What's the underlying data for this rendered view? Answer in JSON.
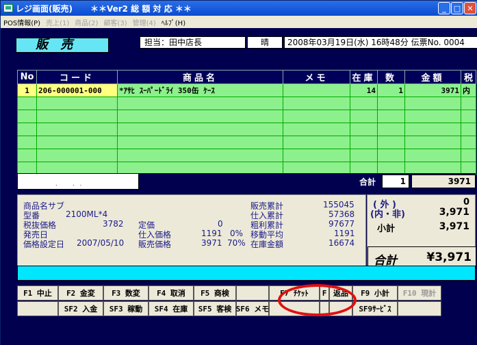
{
  "window": {
    "title": "レジ画面(販売)",
    "subtitle": "＊＊Ver2 総 額 対 応 ＊＊"
  },
  "menu": [
    {
      "label": "POS情報(P)",
      "enabled": true
    },
    {
      "label": "売上(1)",
      "enabled": false
    },
    {
      "label": "商品(2)",
      "enabled": false
    },
    {
      "label": "顧客(3)",
      "enabled": false
    },
    {
      "label": "管理(4)",
      "enabled": false
    },
    {
      "label": "ﾍﾙﾌﾟ(H)",
      "enabled": true
    }
  ],
  "header": {
    "mode": "販 売",
    "tanto": "担当：田中店長",
    "weather": "晴",
    "datetime": "2008年03月19日(水) 16時48分 伝票No. 0004"
  },
  "grid": {
    "columns": [
      "No",
      "コード",
      "商品名",
      "メモ",
      "在庫",
      "数",
      "金額",
      "税"
    ],
    "rows": [
      {
        "no": "1",
        "code": "206-000001-000",
        "name": "*ｱｻﾋ ｽｰﾊﾟｰﾄﾞﾗｲ 350缶 ｹｰｽ",
        "memo": "",
        "stock": "14",
        "qty": "1",
        "amount": "3971",
        "tax": "内"
      }
    ]
  },
  "totals": {
    "label": "合計",
    "qty": "1",
    "amount": "3971"
  },
  "info": {
    "left": [
      {
        "label": "商品名サブ",
        "value": ""
      },
      {
        "label": "型番",
        "value": "2100ML*4"
      },
      {
        "label": "税抜価格",
        "value": "3782"
      },
      {
        "label": "発売日",
        "value": ""
      },
      {
        "label": "価格設定日",
        "value": "2007/05/10"
      }
    ],
    "mid": [
      {
        "label": "定価",
        "value": "0",
        "pct": ""
      },
      {
        "label": "仕入価格",
        "value": "1191",
        "pct": "0%"
      },
      {
        "label": "販売価格",
        "value": "3971",
        "pct": "70%"
      }
    ],
    "right": [
      {
        "label": "販売累計",
        "value": "155045"
      },
      {
        "label": "仕入累計",
        "value": "57368"
      },
      {
        "label": "粗利累計",
        "value": "97677"
      },
      {
        "label": "移動平均",
        "value": "1191"
      },
      {
        "label": "在庫金額",
        "value": "16674"
      }
    ]
  },
  "summary": {
    "outer_label": "( 外 )",
    "outer_value": "0",
    "inner_label": "(内・非)",
    "inner_value": "3,971",
    "subtotal_label": "小計",
    "subtotal_value": "3,971",
    "total_label": "合計",
    "total_value": "¥3,971"
  },
  "fkeys_row1": [
    "F1 中止",
    "F2 金変",
    "F3 数変",
    "F4 取消",
    "F5 商検",
    "",
    "F7 ﾁｹｯﾄ",
    "F",
    "返品",
    "F9 小計",
    "F10 現計"
  ],
  "fkeys_row2": [
    "",
    "SF2 入金",
    "SF3 稼動",
    "SF4 在庫",
    "SF5 客検",
    "SF6 メモ",
    "",
    "",
    "",
    "SF9ｻｰﾋﾞｽ",
    ""
  ]
}
